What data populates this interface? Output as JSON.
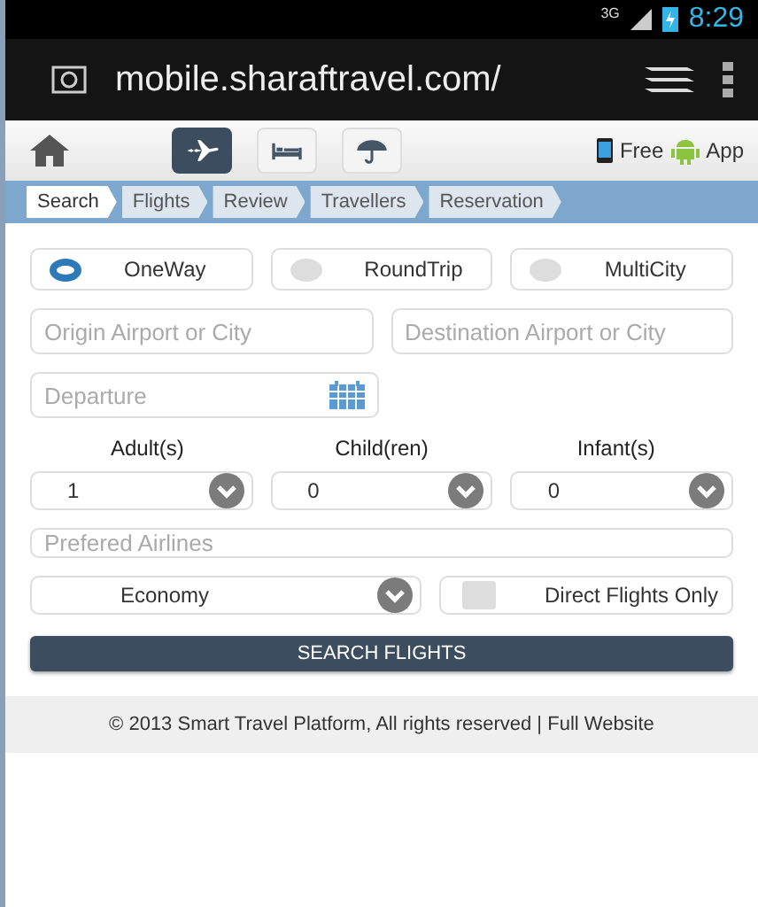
{
  "status_bar": {
    "network": "3G",
    "time": "8:29"
  },
  "browser": {
    "url": "mobile.sharaftravel.com/"
  },
  "nav": {
    "tabs": [
      {
        "kind": "flight",
        "selected": true
      },
      {
        "kind": "hotel",
        "selected": false
      },
      {
        "kind": "insurance",
        "selected": false
      }
    ],
    "free": "Free",
    "app": "App"
  },
  "steps": [
    {
      "label": "Search",
      "selected": true
    },
    {
      "label": "Flights",
      "selected": false
    },
    {
      "label": "Review",
      "selected": false
    },
    {
      "label": "Travellers",
      "selected": false
    },
    {
      "label": "Reservation",
      "selected": false
    }
  ],
  "trip_types": [
    {
      "label": "OneWay",
      "selected": true
    },
    {
      "label": "RoundTrip",
      "selected": false
    },
    {
      "label": "MultiCity",
      "selected": false
    }
  ],
  "origin": {
    "placeholder": "Origin Airport or City"
  },
  "destination": {
    "placeholder": "Destination Airport or City"
  },
  "departure": {
    "placeholder": "Departure"
  },
  "passengers": [
    {
      "label": "Adult(s)",
      "value": "1"
    },
    {
      "label": "Child(ren)",
      "value": "0"
    },
    {
      "label": "Infant(s)",
      "value": "0"
    }
  ],
  "airlines": {
    "placeholder": "Prefered Airlines"
  },
  "cabin": {
    "value": "Economy"
  },
  "direct": {
    "label": "Direct Flights Only",
    "checked": false
  },
  "search_button": "SEARCH FLIGHTS",
  "footer": {
    "text": "© 2013 Smart Travel Platform, All rights reserved |",
    "link": "Full Website"
  }
}
